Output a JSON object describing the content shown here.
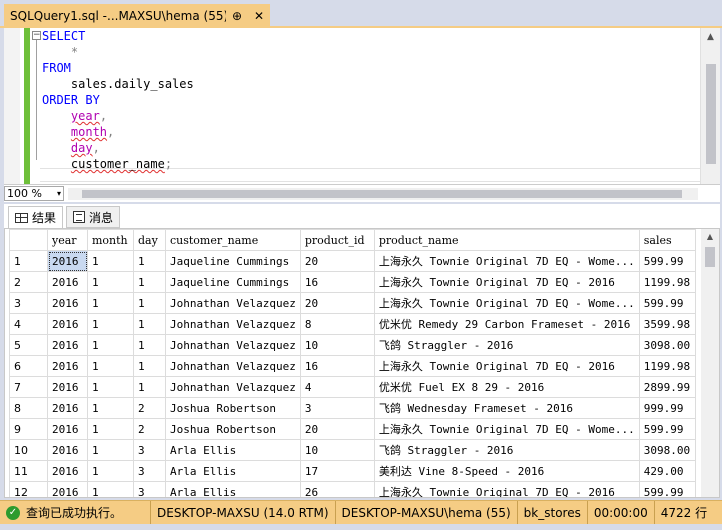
{
  "tab": {
    "title": "SQLQuery1.sql -...MAXSU\\hema (55))",
    "pin_glyph": "⊕",
    "close_glyph": "✕"
  },
  "editor": {
    "fold_glyph": "−",
    "lines": {
      "select": "SELECT",
      "star": "*",
      "from": "FROM",
      "table": "sales.daily_sales",
      "order_by": "ORDER BY",
      "year": "year",
      "month": "month",
      "day": "day",
      "customer_name": "customer_name",
      "comma": ",",
      "semicolon": ";"
    }
  },
  "zoom": {
    "value": "100 %",
    "dropdown_glyph": "▾"
  },
  "result_tabs": {
    "results": "结果",
    "messages": "消息"
  },
  "grid": {
    "columns": [
      "year",
      "month",
      "day",
      "customer_name",
      "product_id",
      "product_name",
      "sales"
    ],
    "rows": [
      [
        "1",
        "2016",
        "1",
        "1",
        "Jaqueline Cummings",
        "20",
        "上海永久 Townie Original 7D EQ - Wome...",
        "599.99"
      ],
      [
        "2",
        "2016",
        "1",
        "1",
        "Jaqueline Cummings",
        "16",
        "上海永久 Townie Original 7D EQ - 2016",
        "1199.98"
      ],
      [
        "3",
        "2016",
        "1",
        "1",
        "Johnathan Velazquez",
        "20",
        "上海永久 Townie Original 7D EQ - Wome...",
        "599.99"
      ],
      [
        "4",
        "2016",
        "1",
        "1",
        "Johnathan Velazquez",
        "8",
        "优米优 Remedy 29 Carbon Frameset - 2016",
        "3599.98"
      ],
      [
        "5",
        "2016",
        "1",
        "1",
        "Johnathan Velazquez",
        "10",
        "飞鸽 Straggler - 2016",
        "3098.00"
      ],
      [
        "6",
        "2016",
        "1",
        "1",
        "Johnathan Velazquez",
        "16",
        "上海永久 Townie Original 7D EQ - 2016",
        "1199.98"
      ],
      [
        "7",
        "2016",
        "1",
        "1",
        "Johnathan Velazquez",
        "4",
        "优米优 Fuel EX 8 29 - 2016",
        "2899.99"
      ],
      [
        "8",
        "2016",
        "1",
        "2",
        "Joshua Robertson",
        "3",
        "飞鸽 Wednesday Frameset - 2016",
        "999.99"
      ],
      [
        "9",
        "2016",
        "1",
        "2",
        "Joshua Robertson",
        "20",
        "上海永久 Townie Original 7D EQ - Wome...",
        "599.99"
      ],
      [
        "10",
        "2016",
        "1",
        "3",
        "Arla Ellis",
        "10",
        "飞鸽 Straggler - 2016",
        "3098.00"
      ],
      [
        "11",
        "2016",
        "1",
        "3",
        "Arla Ellis",
        "17",
        "美利达 Vine 8-Speed - 2016",
        "429.00"
      ],
      [
        "12",
        "2016",
        "1",
        "3",
        "Arla Ellis",
        "26",
        "上海永久 Townie Original 7D EQ - 2016",
        "599.99"
      ]
    ]
  },
  "status": {
    "message": "查询已成功执行。",
    "server": "DESKTOP-MAXSU (14.0 RTM)",
    "connection": "DESKTOP-MAXSU\\hema (55)",
    "database": "bk_stores",
    "elapsed": "00:00:00",
    "rows": "4722 行",
    "ok_glyph": "✓"
  },
  "colors": {
    "accent": "#f5cc84",
    "keyword": "#0000ff",
    "column_ref": "#b000b0",
    "change_bar": "#6ebf3a",
    "selected_cell": "#c9d9f0"
  }
}
